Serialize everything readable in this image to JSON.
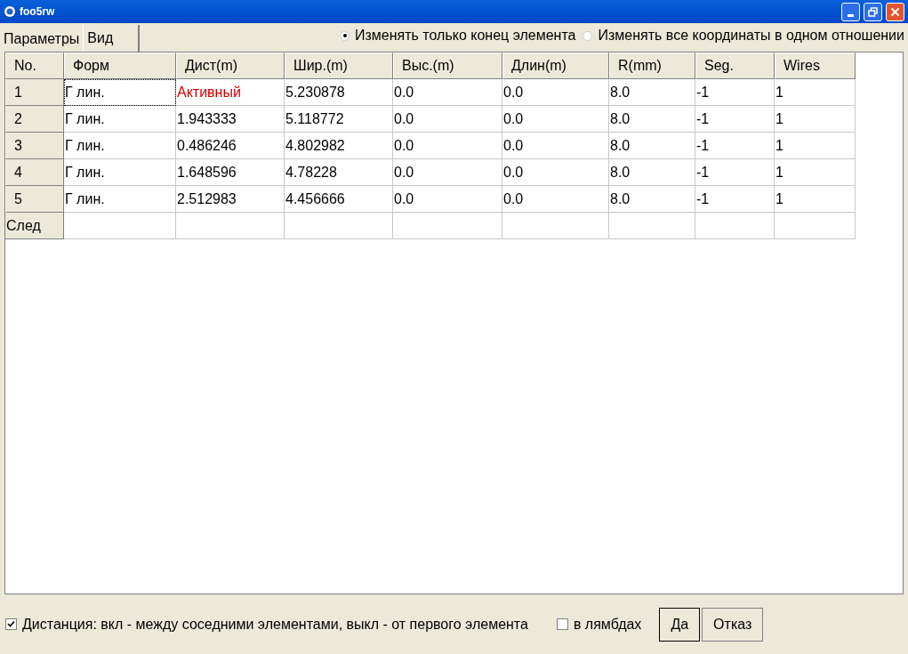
{
  "window": {
    "title": "foo5rw"
  },
  "tabs": [
    {
      "label": "Параметры",
      "selected": true
    },
    {
      "label": "Вид",
      "selected": false
    }
  ],
  "modes": [
    {
      "label": "Изменять только конец элемента",
      "selected": true
    },
    {
      "label": "Изменять все координаты в одном отношении",
      "selected": false
    }
  ],
  "table": {
    "columns": [
      "No.",
      "Форм",
      "Дист(m)",
      "Шир.(m)",
      "Выс.(m)",
      "Длин(m)",
      "R(mm)",
      "Seg.",
      "Wires"
    ],
    "rows": [
      {
        "focused": true,
        "cells": [
          {
            "text": "1"
          },
          {
            "text": "Г лин."
          },
          {
            "text": "Активный",
            "kind": "status"
          },
          {
            "text": "5.230878"
          },
          {
            "text": "0.0"
          },
          {
            "text": "0.0"
          },
          {
            "text": "8.0"
          },
          {
            "text": "-1"
          },
          {
            "text": "1"
          }
        ]
      },
      {
        "focused": false,
        "cells": [
          {
            "text": "2"
          },
          {
            "text": "Г лин."
          },
          {
            "text": "1.943333"
          },
          {
            "text": "5.118772"
          },
          {
            "text": "0.0"
          },
          {
            "text": "0.0"
          },
          {
            "text": "8.0"
          },
          {
            "text": "-1"
          },
          {
            "text": "1"
          }
        ]
      },
      {
        "focused": false,
        "cells": [
          {
            "text": "3"
          },
          {
            "text": "Г лин."
          },
          {
            "text": "0.486246"
          },
          {
            "text": "4.802982"
          },
          {
            "text": "0.0"
          },
          {
            "text": "0.0"
          },
          {
            "text": "8.0"
          },
          {
            "text": "-1"
          },
          {
            "text": "1"
          }
        ]
      },
      {
        "focused": false,
        "cells": [
          {
            "text": "4"
          },
          {
            "text": "Г лин."
          },
          {
            "text": "1.648596"
          },
          {
            "text": "4.78228"
          },
          {
            "text": "0.0"
          },
          {
            "text": "0.0"
          },
          {
            "text": "8.0"
          },
          {
            "text": "-1"
          },
          {
            "text": "1"
          }
        ]
      },
      {
        "focused": false,
        "cells": [
          {
            "text": "5"
          },
          {
            "text": "Г лин."
          },
          {
            "text": "2.512983"
          },
          {
            "text": "4.456666"
          },
          {
            "text": "0.0"
          },
          {
            "text": "0.0"
          },
          {
            "text": "8.0"
          },
          {
            "text": "-1"
          },
          {
            "text": "1"
          }
        ]
      }
    ],
    "next_row": {
      "label": "След"
    }
  },
  "options": [
    {
      "label": "Дистанция: вкл - между соседними элементами, выкл - от первого элемента",
      "checked": true
    },
    {
      "label": "в лямбдах",
      "checked": false
    }
  ],
  "buttons": [
    "Да",
    "Отказ"
  ]
}
